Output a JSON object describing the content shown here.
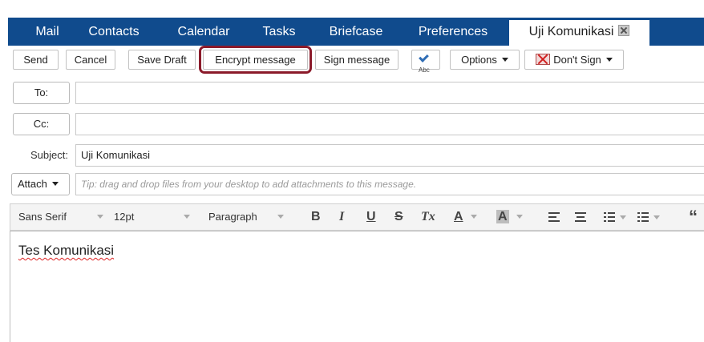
{
  "tabs": [
    {
      "label": "Mail"
    },
    {
      "label": "Contacts"
    },
    {
      "label": "Calendar"
    },
    {
      "label": "Tasks"
    },
    {
      "label": "Briefcase"
    },
    {
      "label": "Preferences"
    },
    {
      "label": "Uji Komunikasi",
      "active": true
    }
  ],
  "toolbar": {
    "send": "Send",
    "cancel": "Cancel",
    "save_draft": "Save Draft",
    "encrypt": "Encrypt message",
    "sign": "Sign message",
    "spell_icon_text": "Abc",
    "options": "Options",
    "dont_sign": "Don't Sign"
  },
  "compose": {
    "to_label": "To:",
    "to_value": "",
    "cc_label": "Cc:",
    "cc_value": "",
    "subject_label": "Subject:",
    "subject_value": "Uji Komunikasi",
    "attach_label": "Attach",
    "attach_tip": "Tip: drag and drop files from your desktop to add attachments to this message."
  },
  "format": {
    "font_family": "Sans Serif",
    "font_size": "12pt",
    "block": "Paragraph",
    "bold": "B",
    "italic": "I",
    "underline": "U",
    "strike": "S",
    "clear": "Tx",
    "font_color": "A",
    "highlight": "A",
    "quote": "“"
  },
  "body": {
    "text": "Tes Komunikasi"
  },
  "colors": {
    "tab_bar": "#104b8d",
    "highlight_frame": "#8b1a2a"
  }
}
